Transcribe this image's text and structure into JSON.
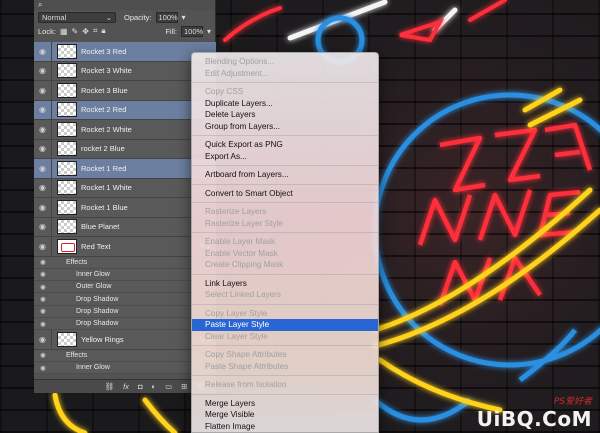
{
  "layers_panel": {
    "blend_mode": "Normal",
    "opacity_label": "Opacity:",
    "opacity_value": "100%",
    "lock_label": "Lock:",
    "fill_label": "Fill:",
    "fill_value": "100%",
    "layers": [
      {
        "name": "Rocket 3 Red",
        "selected": true
      },
      {
        "name": "Rocket 3 White",
        "selected": false
      },
      {
        "name": "Rocket 3 Blue",
        "selected": false
      },
      {
        "name": "Rocket 2 Red",
        "selected": true
      },
      {
        "name": "Rocket 2 White",
        "selected": false
      },
      {
        "name": "rocket 2 Blue",
        "selected": false
      },
      {
        "name": "Rocket 1 Red",
        "selected": true
      },
      {
        "name": "Rocket 1 White",
        "selected": false
      },
      {
        "name": "Rocket 1 Blue",
        "selected": false
      },
      {
        "name": "Blue Planet",
        "selected": false
      }
    ],
    "red_text": {
      "name": "Red Text",
      "effects_label": "Effects",
      "effects": [
        "Inner Glow",
        "Outer Glow",
        "Drop Shadow",
        "Drop Shadow",
        "Drop Shadow"
      ]
    },
    "yellow_rings": {
      "name": "Yellow Rings",
      "effects_label": "Effects",
      "effects": [
        "Inner Glow"
      ]
    },
    "footer_icons": [
      "link-icon",
      "fx-icon",
      "mask-icon",
      "adjustment-icon",
      "folder-icon",
      "new-layer-icon",
      "trash-icon"
    ]
  },
  "context_menu": {
    "groups": [
      [
        {
          "label": "Blending Options...",
          "enabled": false
        },
        {
          "label": "Edit Adjustment...",
          "enabled": false
        }
      ],
      [
        {
          "label": "Copy CSS",
          "enabled": false
        },
        {
          "label": "Duplicate Layers...",
          "enabled": true
        },
        {
          "label": "Delete Layers",
          "enabled": true
        },
        {
          "label": "Group from Layers...",
          "enabled": true
        }
      ],
      [
        {
          "label": "Quick Export as PNG",
          "enabled": true
        },
        {
          "label": "Export As...",
          "enabled": true
        }
      ],
      [
        {
          "label": "Artboard from Layers...",
          "enabled": true
        }
      ],
      [
        {
          "label": "Convert to Smart Object",
          "enabled": true
        }
      ],
      [
        {
          "label": "Rasterize Layers",
          "enabled": false
        },
        {
          "label": "Rasterize Layer Style",
          "enabled": false
        }
      ],
      [
        {
          "label": "Enable Layer Mask",
          "enabled": false
        },
        {
          "label": "Enable Vector Mask",
          "enabled": false
        },
        {
          "label": "Create Clipping Mask",
          "enabled": false
        }
      ],
      [
        {
          "label": "Link Layers",
          "enabled": true
        },
        {
          "label": "Select Linked Layers",
          "enabled": false
        }
      ],
      [
        {
          "label": "Copy Layer Style",
          "enabled": false
        },
        {
          "label": "Paste Layer Style",
          "enabled": true,
          "highlighted": true
        },
        {
          "label": "Clear Layer Style",
          "enabled": false
        }
      ],
      [
        {
          "label": "Copy Shape Attributes",
          "enabled": false
        },
        {
          "label": "Paste Shape Attributes",
          "enabled": false
        }
      ],
      [
        {
          "label": "Release from Isolation",
          "enabled": false
        }
      ],
      [
        {
          "label": "Merge Layers",
          "enabled": true
        },
        {
          "label": "Merge Visible",
          "enabled": true
        },
        {
          "label": "Flatten Image",
          "enabled": true
        }
      ]
    ]
  },
  "watermark": {
    "top": "PS爱好者",
    "main": "UiBQ.CoM"
  },
  "colors": {
    "panel_bg": "#535353",
    "layer_selected": "#6c7fa0",
    "menu_highlight": "#2a66d3",
    "neon_red": "#ff2e3a",
    "neon_blue": "#2b8fe0",
    "neon_yellow": "#ffd21f"
  }
}
